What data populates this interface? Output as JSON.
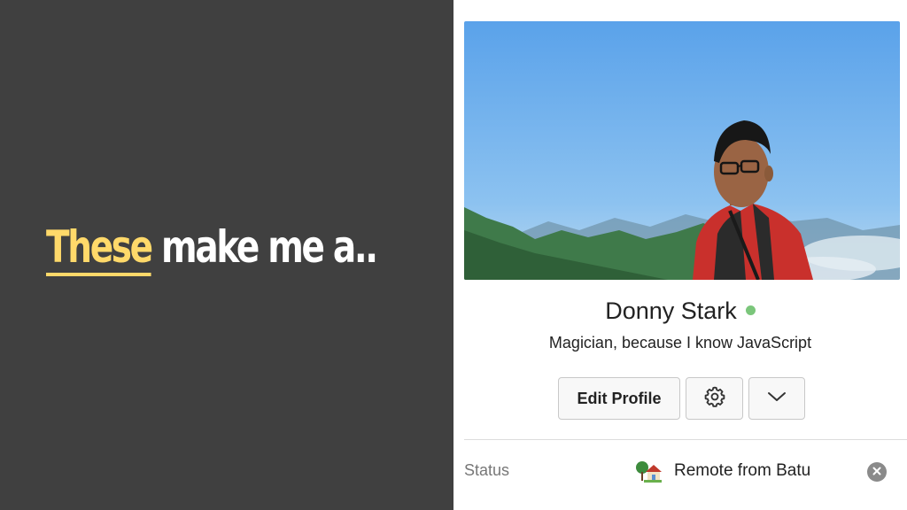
{
  "slide": {
    "headline_highlight": "These",
    "headline_rest": "make me a.."
  },
  "profile": {
    "name": "Donny Stark",
    "title": "Magician, because I know JavaScript",
    "presence": "online",
    "buttons": {
      "edit_label": "Edit Profile",
      "settings_icon": "gear-icon",
      "more_icon": "chevron-down-icon"
    },
    "status": {
      "label": "Status",
      "emoji_icon": "house-with-garden-icon",
      "text": "Remote from Batu",
      "clear_icon": "close-icon"
    }
  },
  "colors": {
    "panel_bg": "#404040",
    "highlight": "#FFD96A",
    "presence_online": "#7bc67b"
  }
}
